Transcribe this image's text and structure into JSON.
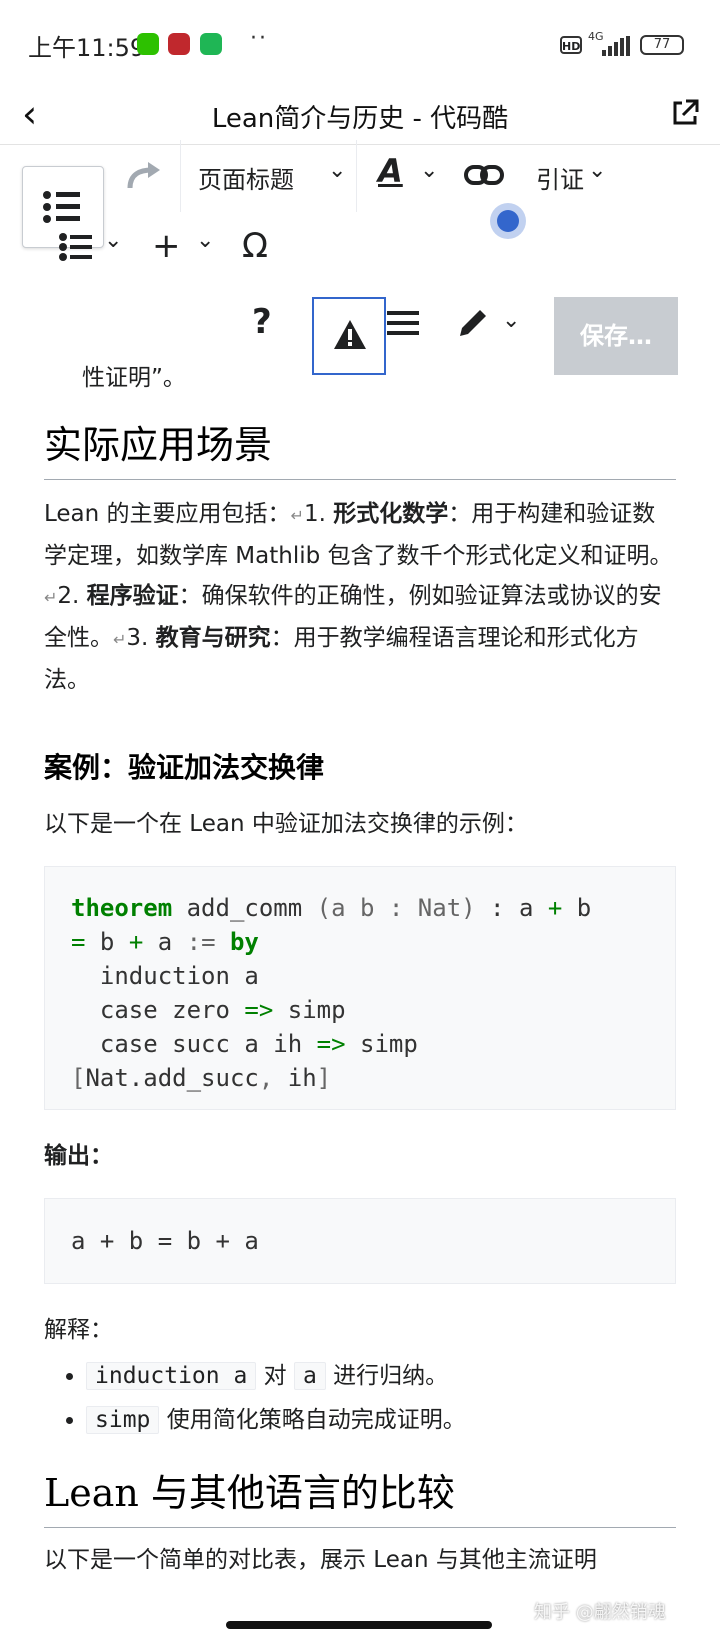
{
  "status": {
    "time": "上午11:59",
    "network": "4G",
    "battery": "77",
    "hd": "HD",
    "dots": "··"
  },
  "header": {
    "back_icon": "chevron-left-icon",
    "title": "Lean简介与历史 - 代码酷",
    "share_icon": "external-link-icon"
  },
  "toolbar": {
    "heading_select": "页面标题",
    "cite": "引证",
    "save": "保存…",
    "help": "?",
    "icons": [
      "toc-icon",
      "redo-icon",
      "text-style-icon",
      "link-icon",
      "list-icon",
      "insert-icon",
      "special-char-icon",
      "help-icon",
      "warning-icon",
      "menu-icon",
      "edit-icon"
    ],
    "omega": "Ω",
    "plus": "+",
    "textA": "A"
  },
  "article": {
    "prev_tail": "性证明”。",
    "h_apps": "实际应用场景",
    "apps_intro": "Lean 的主要应用包括：",
    "apps_1_num": "1. ",
    "apps_1_bold": "形式化数学",
    "apps_1_text": "：用于构建和验证数学定理，如数学库 Mathlib 包含了数千个形式化定义和证明。",
    "apps_2_num": "2. ",
    "apps_2_bold": "程序验证",
    "apps_2_text": "：确保软件的正确性，例如验证算法或协议的安全性。",
    "apps_3_num": "3. ",
    "apps_3_bold": "教育与研究",
    "apps_3_text": "：用于教学编程语言理论和形式化方法。",
    "h_case": "案例：验证加法交换律",
    "case_intro": "以下是一个在 Lean 中验证加法交换律的示例：",
    "code": {
      "kw_theorem": "theorem",
      "l1_rest": " add_comm ",
      "l1_paren": "(a b : Nat)",
      "l1_colon": " : a ",
      "plus": "+",
      "b": " b",
      "eq": "=",
      "l2_b": " b ",
      "l2_a": " a ",
      "assign": ":=",
      "kw_by": "by",
      "l3": "  induction a",
      "l4_a": "  case zero ",
      "arrow": "=>",
      "l4_b": " simp",
      "l5_a": "  case succ a ih ",
      "l5_b": " simp",
      "l6_open": "[",
      "l6_mid": "Nat.add_succ",
      "l6_comma": ", ",
      "l6_ih": "ih",
      "l6_close": "]"
    },
    "output_label": "输出：",
    "output_code": "a + b = b + a",
    "explain_label": "解释：",
    "bullets": [
      {
        "code1": "induction a",
        "t1": "对",
        "code2": "a",
        "t2": "进行归纳。"
      },
      {
        "code1": "simp",
        "t1": "使用简化策略自动完成证明。"
      }
    ],
    "h_compare": "Lean 与其他语言的比较",
    "compare_intro": "以下是一个简单的对比表，展示 Lean 与其他主流证明"
  },
  "watermark": "知乎 @翩然销魂"
}
